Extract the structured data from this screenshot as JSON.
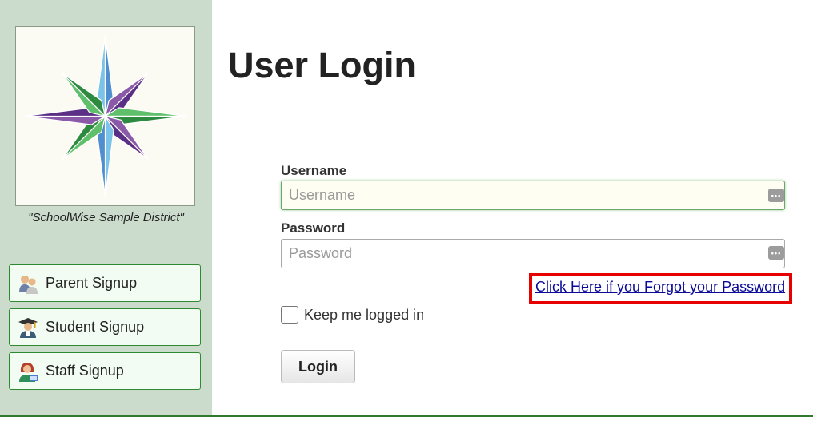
{
  "sidebar": {
    "district_name": "\"SchoolWise Sample District\"",
    "buttons": [
      {
        "label": "Parent Signup",
        "icon": "parents-icon"
      },
      {
        "label": "Student Signup",
        "icon": "graduate-icon"
      },
      {
        "label": "Staff Signup",
        "icon": "teacher-icon"
      }
    ]
  },
  "main": {
    "title": "User Login",
    "username": {
      "label": "Username",
      "placeholder": "Username",
      "value": ""
    },
    "password": {
      "label": "Password",
      "placeholder": "Password",
      "value": ""
    },
    "forgot_link": "Click Here if you Forgot your Password",
    "keep_logged_in": {
      "label": "Keep me logged in",
      "checked": false
    },
    "login_button": "Login"
  },
  "colors": {
    "sidebar_bg": "#ccdccc",
    "button_border": "#2f8a2f",
    "highlight_box": "#e60000",
    "link": "#0a0a99"
  }
}
